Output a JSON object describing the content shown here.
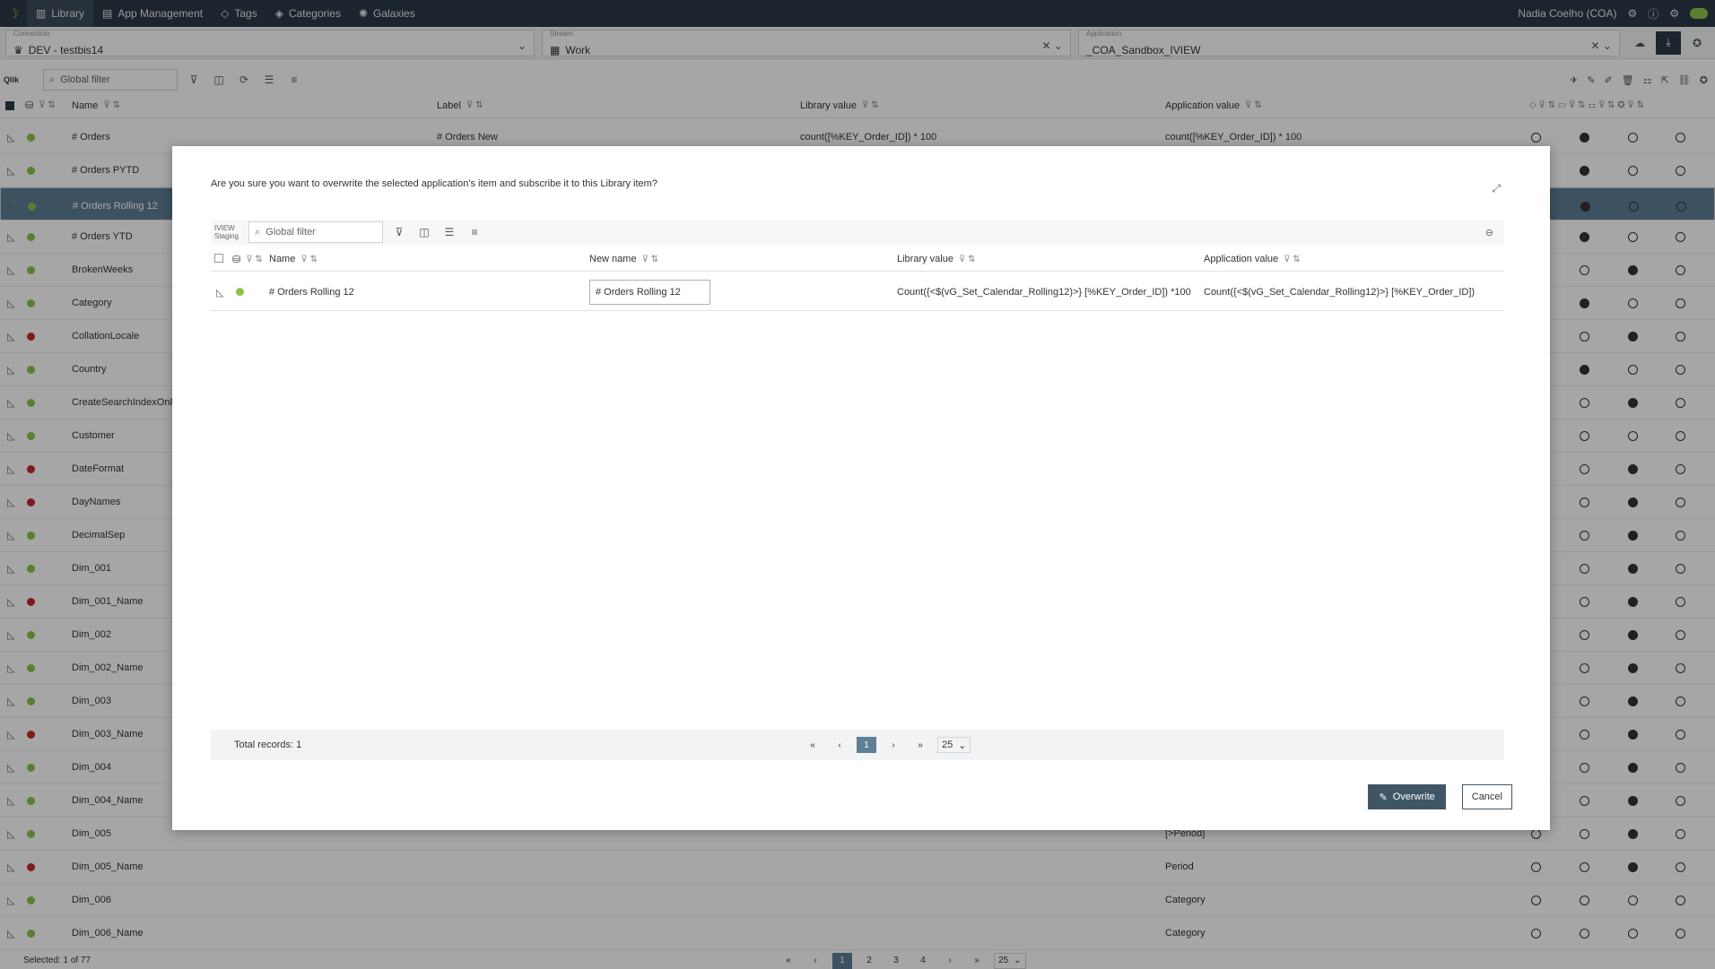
{
  "nav": {
    "items": [
      "Library",
      "App Management",
      "Tags",
      "Categories",
      "Galaxies"
    ],
    "user": "Nadia Coelho (COA)"
  },
  "selectors": {
    "connection_label": "Connection",
    "connection_value": "DEV - testbis14",
    "stream_label": "Stream",
    "stream_value": "Work",
    "application_label": "Application",
    "application_value": "_COA_Sandbox_IVIEW"
  },
  "toolbar": {
    "qlik": "Qlik",
    "filter_placeholder": "Global filter"
  },
  "table": {
    "headers": [
      "Name",
      "Label",
      "Library value",
      "Application value"
    ],
    "rows": [
      {
        "name": "# Orders",
        "label": "# Orders New",
        "lib": "count([%KEY_Order_ID]) * 100",
        "app": "count([%KEY_Order_ID]) * 100",
        "status": "green",
        "c": [
          0,
          1,
          0,
          0
        ]
      },
      {
        "name": "# Orders PYTD",
        "label": "",
        "lib": "",
        "app": "",
        "status": "green",
        "c": [
          0,
          1,
          0,
          0
        ]
      },
      {
        "name": "# Orders Rolling 12",
        "label": "",
        "lib": "",
        "app": "",
        "status": "green",
        "c": [
          0,
          1,
          0,
          0
        ],
        "sel": true
      },
      {
        "name": "# Orders YTD",
        "label": "",
        "lib": "",
        "app": "",
        "status": "green",
        "c": [
          0,
          1,
          0,
          0
        ]
      },
      {
        "name": "BrokenWeeks",
        "label": "",
        "lib": "",
        "app": "",
        "status": "green",
        "c": [
          0,
          0,
          1,
          0
        ]
      },
      {
        "name": "Category",
        "label": "",
        "lib": "",
        "app": "",
        "status": "green",
        "c": [
          0,
          1,
          0,
          0
        ]
      },
      {
        "name": "CollationLocale",
        "label": "",
        "lib": "",
        "app": "",
        "status": "red",
        "c": [
          0,
          0,
          1,
          0
        ]
      },
      {
        "name": "Country",
        "label": "",
        "lib": "",
        "app": "",
        "status": "green",
        "c": [
          0,
          1,
          0,
          0
        ]
      },
      {
        "name": "CreateSearchIndexOnRe",
        "label": "",
        "lib": "",
        "app": "",
        "status": "green",
        "c": [
          0,
          0,
          1,
          0
        ]
      },
      {
        "name": "Customer",
        "label": "",
        "lib": "",
        "app": "",
        "status": "green",
        "c": [
          0,
          0,
          0,
          0
        ]
      },
      {
        "name": "DateFormat",
        "label": "",
        "lib": "",
        "app": "",
        "status": "red",
        "c": [
          0,
          0,
          1,
          0
        ]
      },
      {
        "name": "DayNames",
        "label": "",
        "lib": "",
        "app": "",
        "status": "red",
        "c": [
          0,
          0,
          1,
          0
        ]
      },
      {
        "name": "DecimalSep",
        "label": "",
        "lib": "",
        "app": "",
        "status": "green",
        "c": [
          0,
          0,
          1,
          0
        ]
      },
      {
        "name": "Dim_001",
        "label": "",
        "lib": "",
        "app": "",
        "status": "green",
        "c": [
          0,
          0,
          1,
          0
        ]
      },
      {
        "name": "Dim_001_Name",
        "label": "",
        "lib": "",
        "app": "",
        "status": "red",
        "c": [
          0,
          0,
          1,
          0
        ]
      },
      {
        "name": "Dim_002",
        "label": "",
        "lib": "",
        "app": "",
        "status": "green",
        "c": [
          0,
          0,
          1,
          0
        ]
      },
      {
        "name": "Dim_002_Name",
        "label": "",
        "lib": "",
        "app": "",
        "status": "green",
        "c": [
          0,
          0,
          1,
          0
        ]
      },
      {
        "name": "Dim_003",
        "label": "",
        "lib": "",
        "app": "",
        "status": "green",
        "c": [
          0,
          0,
          1,
          0
        ]
      },
      {
        "name": "Dim_003_Name",
        "label": "",
        "lib": "",
        "app": "",
        "status": "red",
        "c": [
          0,
          0,
          1,
          0
        ]
      },
      {
        "name": "Dim_004",
        "label": "",
        "lib": "",
        "app": "",
        "status": "green",
        "c": [
          0,
          0,
          1,
          0
        ]
      },
      {
        "name": "Dim_004_Name",
        "label": "",
        "lib": "",
        "app": "",
        "status": "green",
        "c": [
          0,
          0,
          1,
          0
        ]
      },
      {
        "name": "Dim_005",
        "label": "",
        "lib": "",
        "app": "[>Period]",
        "status": "green",
        "c": [
          0,
          0,
          1,
          0
        ]
      },
      {
        "name": "Dim_005_Name",
        "label": "",
        "lib": "",
        "app": "Period",
        "status": "red",
        "c": [
          0,
          0,
          1,
          0
        ]
      },
      {
        "name": "Dim_006",
        "label": "",
        "lib": "",
        "app": "Category",
        "status": "green",
        "c": [
          0,
          0,
          0,
          0
        ]
      },
      {
        "name": "Dim_006_Name",
        "label": "",
        "lib": "",
        "app": "Category",
        "status": "green",
        "c": [
          0,
          0,
          0,
          0
        ]
      }
    ]
  },
  "footer": {
    "selected": "Selected: 1 of 77",
    "pages": [
      "1",
      "2",
      "3",
      "4"
    ],
    "page_size": "25"
  },
  "modal": {
    "question": "Are you sure you want to overwrite the selected application's item and subscribe it to this Library item?",
    "staging_label": "IVIEW Staging",
    "filter_placeholder": "Global filter",
    "headers": [
      "Name",
      "New name",
      "Library value",
      "Application value"
    ],
    "row": {
      "name": "# Orders Rolling 12",
      "new_name": "# Orders Rolling 12",
      "lib": "Count({<$(vG_Set_Calendar_Rolling12)>} [%KEY_Order_ID]) *100",
      "app": "Count({<$(vG_Set_Calendar_Rolling12)>} [%KEY_Order_ID])"
    },
    "total": "Total records: 1",
    "page": "1",
    "page_size": "25",
    "overwrite": "Overwrite",
    "cancel": "Cancel"
  }
}
